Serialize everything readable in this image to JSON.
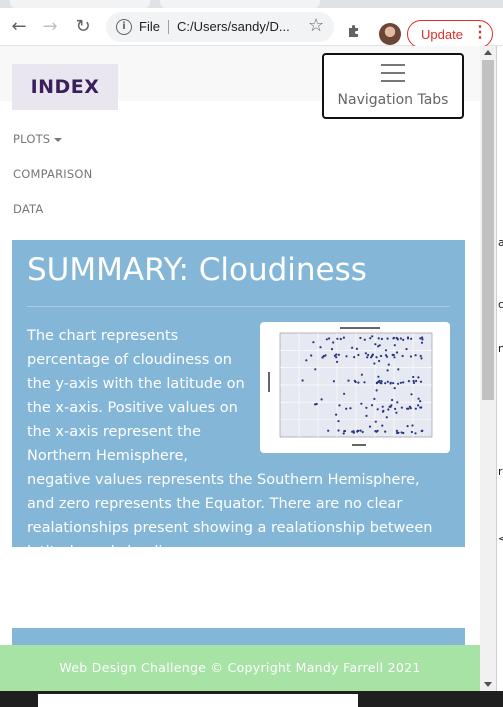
{
  "browser": {
    "address_scheme": "File",
    "address_url": "C:/Users/sandy/D...",
    "update_label": "Update",
    "update_menu_glyph": "⋮",
    "back_icon": "back-arrow-icon",
    "forward_icon": "forward-arrow-icon",
    "reload_icon": "reload-icon",
    "back_glyph": "←",
    "forward_glyph": "→",
    "reload_glyph": "↻",
    "info_glyph": "i",
    "star_glyph": "☆",
    "accent_color": "#d93025"
  },
  "page": {
    "brand": "INDEX",
    "nav_toggle_label": "Navigation Tabs",
    "menu": [
      {
        "label": "PLOTS",
        "has_dropdown": true
      },
      {
        "label": "COMPARISON"
      },
      {
        "label": "DATA"
      }
    ],
    "summary": {
      "title": "SUMMARY: Cloudiness",
      "body": "The chart represents percentage of cloudiness on the y-axis with the latitude on the x-axis. Positive values on the x-axis represent the Northern Hemisphere, negative values represents the Southern Hemisphere, and zero represents the Equator. There are no clear realationships present showing a realationship between latitude and cloudiness.",
      "panel_color": "#84b7d7"
    },
    "footer": "Web Design Challenge © Copyright Mandy Farrell 2021",
    "footer_color": "#a7e3a5"
  },
  "side_window_glyphs": [
    "a",
    "c",
    "n",
    "re",
    "<"
  ]
}
